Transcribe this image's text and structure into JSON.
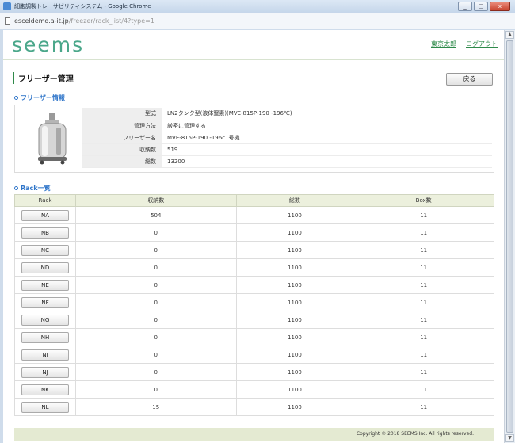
{
  "window": {
    "title": "細胞調製トレーサビリティシステム - Google Chrome",
    "url_host": "esceldemo.a-it.jp",
    "url_path": "/freezer/rack_list/4?type=1",
    "buttons": [
      "_",
      "□",
      "x"
    ]
  },
  "header": {
    "logo": "seems",
    "user": "東京太郎",
    "logout": "ログアウト"
  },
  "page": {
    "title": "フリーザー管理",
    "back_label": "戻る"
  },
  "freezer_info": {
    "section_title": "フリーザー情報",
    "rows": [
      {
        "label": "型式",
        "value": "LN2タンク型(液体窒素)(MVE-815P-190 -196℃)"
      },
      {
        "label": "管理方法",
        "value": "厳密に管理する"
      },
      {
        "label": "フリーザー名",
        "value": "MVE-815P-190 -196c1号機"
      },
      {
        "label": "収納数",
        "value": "519"
      },
      {
        "label": "総数",
        "value": "13200"
      }
    ]
  },
  "rack_list": {
    "section_title": "Rack一覧",
    "headers": [
      "Rack",
      "収納数",
      "総数",
      "Box数"
    ],
    "rows": [
      {
        "rack": "NA",
        "stored": "504",
        "total": "1100",
        "boxes": "11"
      },
      {
        "rack": "NB",
        "stored": "0",
        "total": "1100",
        "boxes": "11"
      },
      {
        "rack": "NC",
        "stored": "0",
        "total": "1100",
        "boxes": "11"
      },
      {
        "rack": "ND",
        "stored": "0",
        "total": "1100",
        "boxes": "11"
      },
      {
        "rack": "NE",
        "stored": "0",
        "total": "1100",
        "boxes": "11"
      },
      {
        "rack": "NF",
        "stored": "0",
        "total": "1100",
        "boxes": "11"
      },
      {
        "rack": "NG",
        "stored": "0",
        "total": "1100",
        "boxes": "11"
      },
      {
        "rack": "NH",
        "stored": "0",
        "total": "1100",
        "boxes": "11"
      },
      {
        "rack": "NI",
        "stored": "0",
        "total": "1100",
        "boxes": "11"
      },
      {
        "rack": "NJ",
        "stored": "0",
        "total": "1100",
        "boxes": "11"
      },
      {
        "rack": "NK",
        "stored": "0",
        "total": "1100",
        "boxes": "11"
      },
      {
        "rack": "NL",
        "stored": "15",
        "total": "1100",
        "boxes": "11"
      }
    ]
  },
  "footer": {
    "copyright": "Copyright © 2018 SEEMS Inc. All rights reserved."
  },
  "colors": {
    "brand": "#4aa78a",
    "link": "#2e8a4a",
    "section": "#2f75c9",
    "table_header": "#ecf0dd"
  }
}
